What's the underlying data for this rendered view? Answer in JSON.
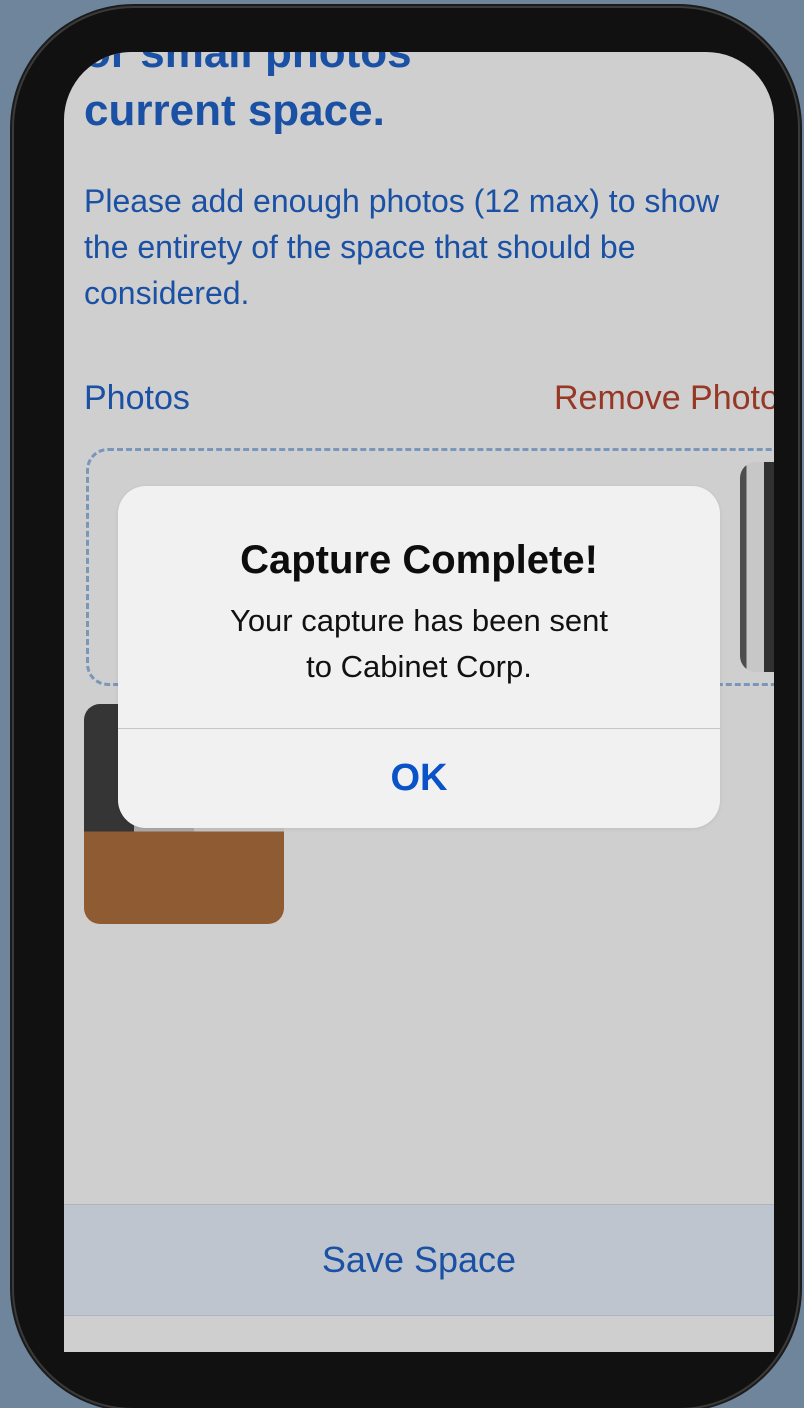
{
  "page": {
    "title_visible_line": "current space.",
    "title_cut_line": "or small photos",
    "instructions": "Please add enough photos (12 max) to show\nthe entirety of the space that should be\nconsidered.",
    "photos_label": "Photos",
    "remove_photos_label": "Remove Photos",
    "save_button_label": "Save Space"
  },
  "alert": {
    "title": "Capture Complete!",
    "message": "Your capture has been sent\nto Cabinet Corp.",
    "ok_label": "OK"
  },
  "colors": {
    "accent": "#1f5fbf",
    "destructive": "#b0402d",
    "alert_button": "#0a52c8",
    "background": "#6e859b"
  },
  "icons": {
    "photo_thumbnail_left": "room-photo",
    "photo_thumbnail_right": "room-photo"
  }
}
